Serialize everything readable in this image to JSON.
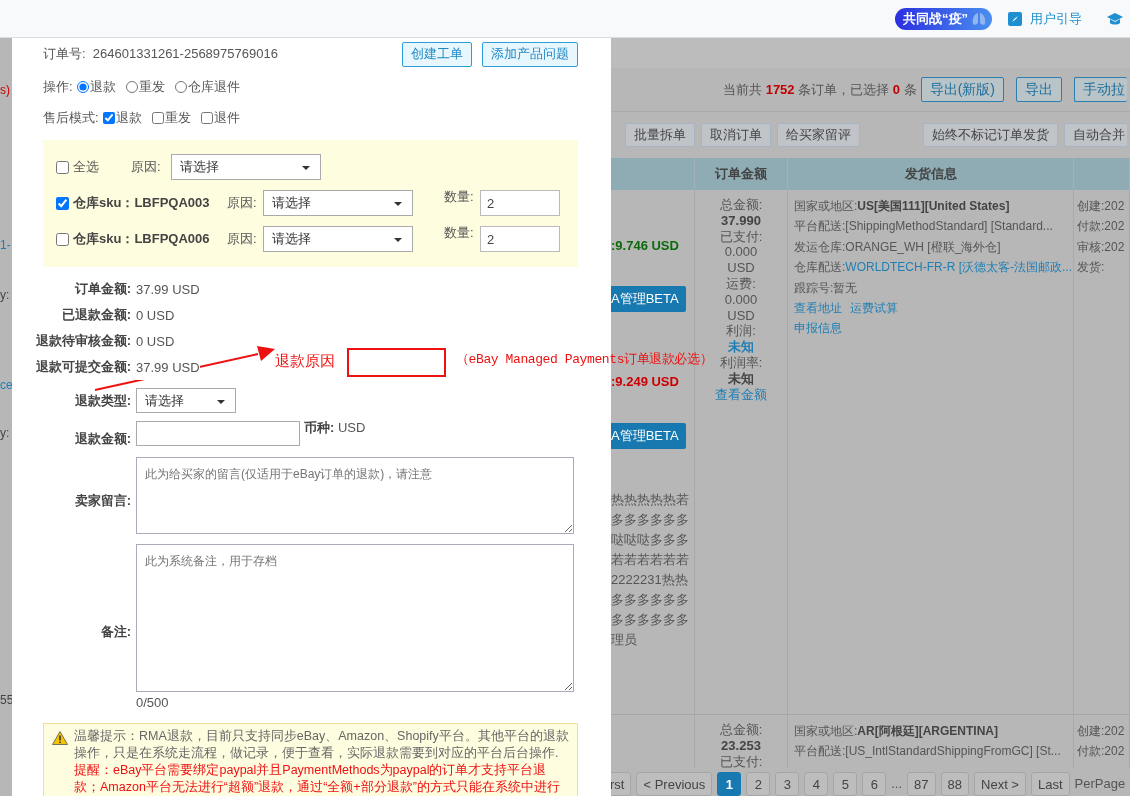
{
  "top_bar": {
    "campaign_badge": "共同战“疫”",
    "links": [
      {
        "label": "用户引导"
      }
    ]
  },
  "dialog": {
    "order_no": {
      "label": "订单号:",
      "value": "264601331261-2568975769016"
    },
    "header_buttons": [
      "创建工单",
      "添加产品问题"
    ],
    "operation": {
      "label": "操作:",
      "options": [
        {
          "label": "退款",
          "selected": true
        },
        {
          "label": "重发",
          "selected": false
        },
        {
          "label": "仓库退件",
          "selected": false
        }
      ]
    },
    "after_sale_mode": {
      "label": "售后模式:",
      "options": [
        {
          "label": "退款",
          "checked": true
        },
        {
          "label": "重发",
          "checked": false
        },
        {
          "label": "退件",
          "checked": false
        }
      ]
    },
    "items_panel": {
      "select_all": {
        "label": "全选",
        "checked": false
      },
      "reason_label": "原因:",
      "reason_value": "请选择",
      "items": [
        {
          "sku": "仓库sku：LBFPQA003",
          "checked": true,
          "reason_label": "原因:",
          "reason_value": "请选择",
          "quantity_label": "数量:",
          "quantity": "2"
        },
        {
          "sku": "仓库sku：LBFPQA006",
          "checked": false,
          "reason_label": "原因:",
          "reason_value": "请选择",
          "quantity_label": "数量:",
          "quantity": "2"
        }
      ]
    },
    "amounts": [
      {
        "label": "订单金额:",
        "value": "37.99 USD"
      },
      {
        "label": "已退款金额:",
        "value": "0 USD"
      },
      {
        "label": "退款待审核金额:",
        "value": "0 USD"
      },
      {
        "label": "退款可提交金额:",
        "value": "37.99 USD"
      }
    ],
    "refund_type": {
      "label": "退款类型:",
      "value": "请选择"
    },
    "refund_amount": {
      "label": "退款金额:",
      "currency": "**币种:** USD"
    },
    "seller_message": {
      "label": "卖家留言:",
      "placeholder": "此为给买家的留言(仅适用于eBay订单的退款)，请注意"
    },
    "remark": {
      "label": "备注:",
      "placeholder": "此为系统备注，用于存档",
      "counter": "0/500"
    },
    "notice": {
      "tip": "温馨提示：RMA退款，目前只支持同步eBay、Amazon、Shopify平台。其他平台的退款操作，只是在系统走流程，做记录，便于查看，实际退款需要到对应的平台后台操作.",
      "reminder": "提醒：eBay平台需要绑定paypal并且PaymentMethods为paypal的订单才支持平台退款；Amazon平台无法进行“超额”退款，通过“全额+部分退款”的方式只能在系统中进行"
    }
  },
  "annotation": {
    "label": "退款原因",
    "note": "（eBay Managed Payments订单退款必选）"
  },
  "background": {
    "left_fragments": [
      {
        "text": "s)",
        "kind": "alert"
      },
      {
        "text": "1-",
        "kind": "link"
      },
      {
        "text": "y:",
        "kind": "plain"
      },
      {
        "text": "ce",
        "kind": "link"
      },
      {
        "text": "y:",
        "kind": "plain"
      },
      {
        "text": "55",
        "kind": "plain"
      }
    ],
    "summary": "当前共 **1752** 条订单，已选择 **0** 条",
    "export_buttons": [
      "导出(新版)",
      "导出",
      "手动拉"
    ],
    "action_buttons": [
      "批量拆单",
      "取消订单",
      "给买家留评"
    ],
    "right_buttons": [
      "始终不标记订单发货",
      "自动合并"
    ],
    "table": {
      "columns": [
        "订单金额",
        "发货信息"
      ],
      "rows": [
        {
          "column_1": [
            {
              "kind": "gain",
              "text": ":9.746 USD"
            },
            {
              "kind": "menu",
              "text": "A管理BETA"
            },
            {
              "kind": "loss",
              "text": ":9.249 USD"
            },
            {
              "kind": "menu",
              "text": "A管理BETA"
            },
            {
              "kind": "note",
              "text": "热热热热热若"
            },
            {
              "kind": "note",
              "text": "多多多多多多"
            },
            {
              "kind": "note",
              "text": "哒哒哒多多多"
            },
            {
              "kind": "note",
              "text": "若若若若若若"
            },
            {
              "kind": "note",
              "text": "2222231热热"
            },
            {
              "kind": "note",
              "text": "多多多多多多"
            },
            {
              "kind": "note",
              "text": "多多多多多多"
            },
            {
              "kind": "note",
              "text": "理员"
            }
          ],
          "amount": [
            {
              "kind": "plain",
              "text": "总金额:"
            },
            {
              "kind": "bold",
              "text": "37.990"
            },
            {
              "kind": "plain",
              "text": "已支付:"
            },
            {
              "kind": "plain",
              "text": "0.000"
            },
            {
              "kind": "plain",
              "text": "USD"
            },
            {
              "kind": "plain",
              "text": "运费:"
            },
            {
              "kind": "plain",
              "text": "0.000"
            },
            {
              "kind": "plain",
              "text": "USD"
            },
            {
              "kind": "plain",
              "text": "利润:"
            },
            {
              "kind": "accent",
              "text": "未知"
            },
            {
              "kind": "plain",
              "text": "利润率:"
            },
            {
              "kind": "bold",
              "text": "未知"
            },
            {
              "kind": "link",
              "text": "查看金额"
            }
          ],
          "shipping": [
            {
              "kind": "bold",
              "label": "国家或地区:",
              "value": "US[美国111][United States]"
            },
            {
              "kind": "plain",
              "label": "平台配送:",
              "value": "[ShippingMethodStandard] [Standard..."
            },
            {
              "kind": "plain",
              "label": "发运仓库:",
              "value": "ORANGE_WH [橙联_海外仓]"
            },
            {
              "kind": "link",
              "label": "仓库配送:",
              "value": "WORLDTECH-FR-R [沃德太客-法国邮政..."
            },
            {
              "kind": "plain",
              "label": "跟踪号:",
              "value": "暂无"
            },
            {
              "kind": "links",
              "links": [
                "查看地址",
                "运费试算"
              ]
            },
            {
              "kind": "links",
              "links": [
                "申报信息"
              ]
            }
          ],
          "dates": [
            "创建:202",
            "付款:202",
            "审核:202",
            "发货:"
          ]
        },
        {
          "column_1": [],
          "amount": [
            {
              "kind": "plain",
              "text": "总金额:"
            },
            {
              "kind": "bold",
              "text": "23.253"
            },
            {
              "kind": "plain",
              "text": "已支付:"
            }
          ],
          "shipping": [
            {
              "kind": "bold",
              "label": "国家或地区:",
              "value": "AR[阿根廷][ARGENTINA]"
            },
            {
              "kind": "plain",
              "label": "平台配送:",
              "value": "[US_IntlStandardShippingFromGC] [St..."
            }
          ],
          "dates": [
            "创建:202",
            "付款:202"
          ]
        }
      ]
    },
    "pagination": {
      "items": [
        {
          "kind": "button",
          "label": "rst",
          "selected": false
        },
        {
          "kind": "button",
          "label": "< Previous",
          "selected": false
        },
        {
          "kind": "button",
          "label": "1",
          "selected": true
        },
        {
          "kind": "button",
          "label": "2",
          "selected": false
        },
        {
          "kind": "button",
          "label": "3",
          "selected": false
        },
        {
          "kind": "button",
          "label": "4",
          "selected": false
        },
        {
          "kind": "button",
          "label": "5",
          "selected": false
        },
        {
          "kind": "button",
          "label": "6",
          "selected": false
        },
        {
          "kind": "gap",
          "label": "..."
        },
        {
          "kind": "button",
          "label": "87",
          "selected": false
        },
        {
          "kind": "button",
          "label": "88",
          "selected": false
        },
        {
          "kind": "button",
          "label": "Next >",
          "selected": false
        },
        {
          "kind": "button",
          "label": "Last",
          "selected": false
        }
      ],
      "per_page_label": "PerPage"
    }
  }
}
